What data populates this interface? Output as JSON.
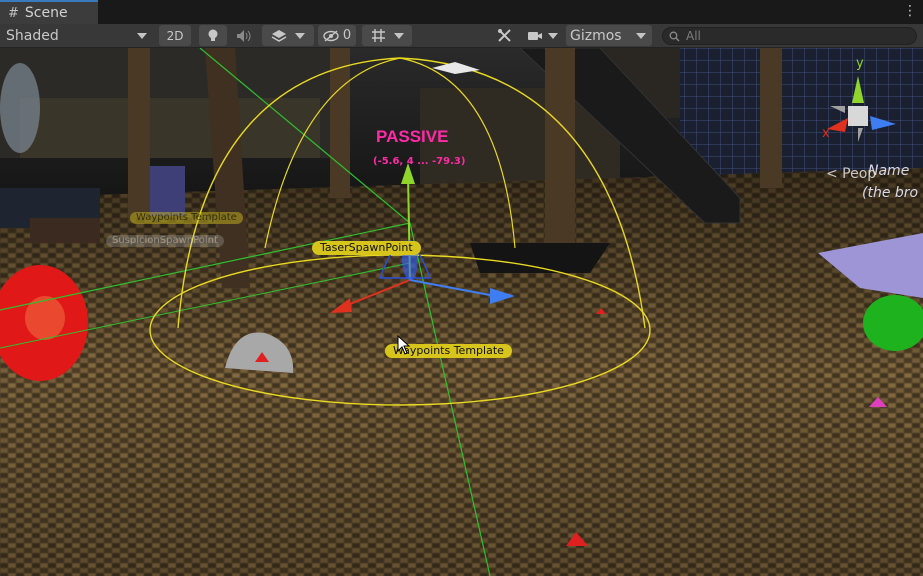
{
  "tab": {
    "icon": "grid-hash-icon",
    "title": "Scene",
    "menu_icon": "kebab-menu-icon"
  },
  "toolbar": {
    "draw_mode": "Shaded",
    "mode_2d": "2D",
    "light_icon": "lightbulb-icon",
    "audio_icon": "speaker-icon",
    "effects_icon": "layers-icon",
    "visibility_icon": "eye-slash-icon",
    "hidden_count": "0",
    "grid_icon": "grid-snap-icon",
    "tools_icon": "crossed-tools-icon",
    "camera_icon": "camera-icon",
    "gizmos_label": "Gizmos",
    "search_placeholder": "All",
    "search_icon": "search-icon"
  },
  "scene": {
    "status_label": "PASSIVE",
    "position_readout": "(-5.6, 4 ... -79.3)",
    "labels": {
      "taser_spawn": "TaserSpawnPoint",
      "waypoints": "Waypoints Template",
      "faint_left_1": "Waypoints Template",
      "faint_left_2": "SuspicionSpawnPoint"
    },
    "right_text_1": "< Peop",
    "right_text_2": "Name",
    "right_text_3": "(the bro",
    "orientation_gizmo": {
      "y": "y",
      "x": "x"
    },
    "colors": {
      "gizmo_x": "#e0301e",
      "gizmo_y": "#8fd52a",
      "gizmo_z": "#3f7ef2",
      "label_bg": "#d7c51c",
      "status": "#ff2aa8"
    }
  }
}
